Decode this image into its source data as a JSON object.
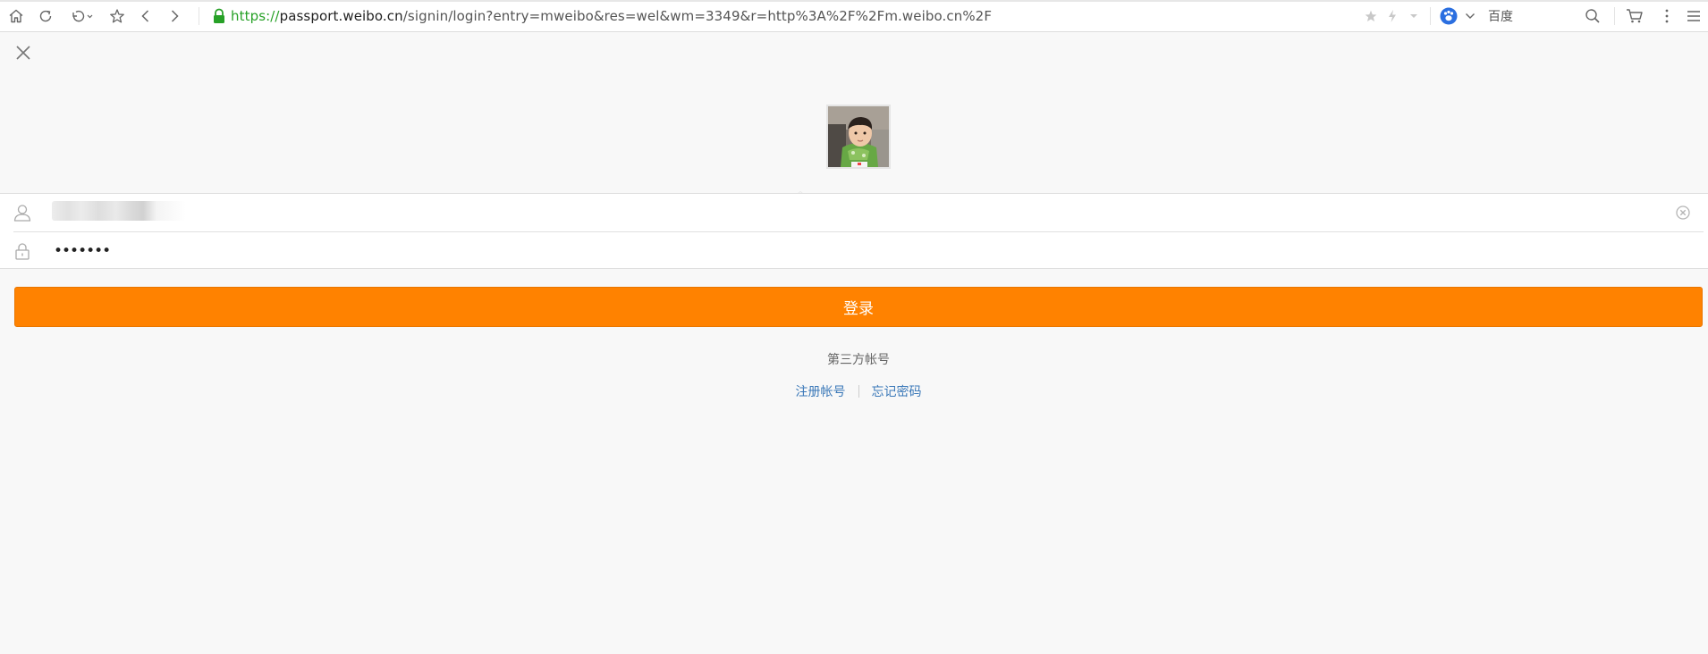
{
  "browser": {
    "url_scheme": "https://",
    "url_host": "passport.weibo.cn",
    "url_path": "/signin/login?entry=mweibo&res=wel&wm=3349&r=http%3A%2F%2Fm.weibo.cn%2F",
    "search_engine": "百度",
    "icons": [
      "home-icon",
      "refresh-icon",
      "undo-icon",
      "favorite-star-icon",
      "back-icon",
      "forward-icon",
      "lock-icon",
      "bookmark-star-icon",
      "lightning-icon",
      "dropdown-icon",
      "baidu-paw-icon",
      "chevron-down-icon",
      "search-icon",
      "cart-icon",
      "more-vertical-icon",
      "menu-icon"
    ],
    "secure_color": "#27a127"
  },
  "login": {
    "password_mask": "•••••••",
    "login_label": "登录",
    "third_party_label": "第三方帐号",
    "register_label": "注册帐号",
    "forgot_label": "忘记密码",
    "button_color": "#ff8200",
    "link_color": "#3a78b8"
  }
}
